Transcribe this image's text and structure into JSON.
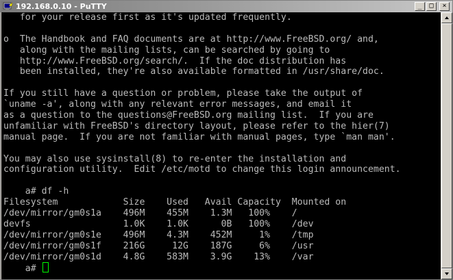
{
  "window": {
    "title": "192.168.0.10 - PuTTY",
    "app_icon": "putty-terminal-icon",
    "buttons": {
      "minimize": "_",
      "maximize": "□",
      "close": "×"
    }
  },
  "terminal": {
    "foreground": "#bbbbbb",
    "background": "#000000",
    "cursor_color": "#00ff00",
    "lines": [
      "   for your release first as it's updated frequently.",
      "",
      "o  The Handbook and FAQ documents are at http://www.FreeBSD.org/ and,",
      "   along with the mailing lists, can be searched by going to",
      "   http://www.FreeBSD.org/search/.  If the doc distribution has",
      "   been installed, they're also available formatted in /usr/share/doc.",
      "",
      "If you still have a question or problem, please take the output of",
      "`uname -a', along with any relevant error messages, and email it",
      "as a question to the questions@FreeBSD.org mailing list.  If you are",
      "unfamiliar with FreeBSD's directory layout, please refer to the hier(7)",
      "manual page.  If you are not familiar with manual pages, type `man man'.",
      "",
      "You may also use sysinstall(8) to re-enter the installation and",
      "configuration utility.  Edit /etc/motd to change this login announcement.",
      "",
      "    a# df -h",
      "Filesystem            Size    Used   Avail Capacity  Mounted on",
      "/dev/mirror/gm0s1a    496M    455M    1.3M   100%    /",
      "devfs                 1.0K    1.0K      0B   100%    /dev",
      "/dev/mirror/gm0s1e    496M    4.3M    452M     1%    /tmp",
      "/dev/mirror/gm0s1f    216G     12G    187G     6%    /usr",
      "/dev/mirror/gm0s1d    4.8G    583M    3.9G    13%    /var"
    ],
    "prompt": "    a# "
  }
}
